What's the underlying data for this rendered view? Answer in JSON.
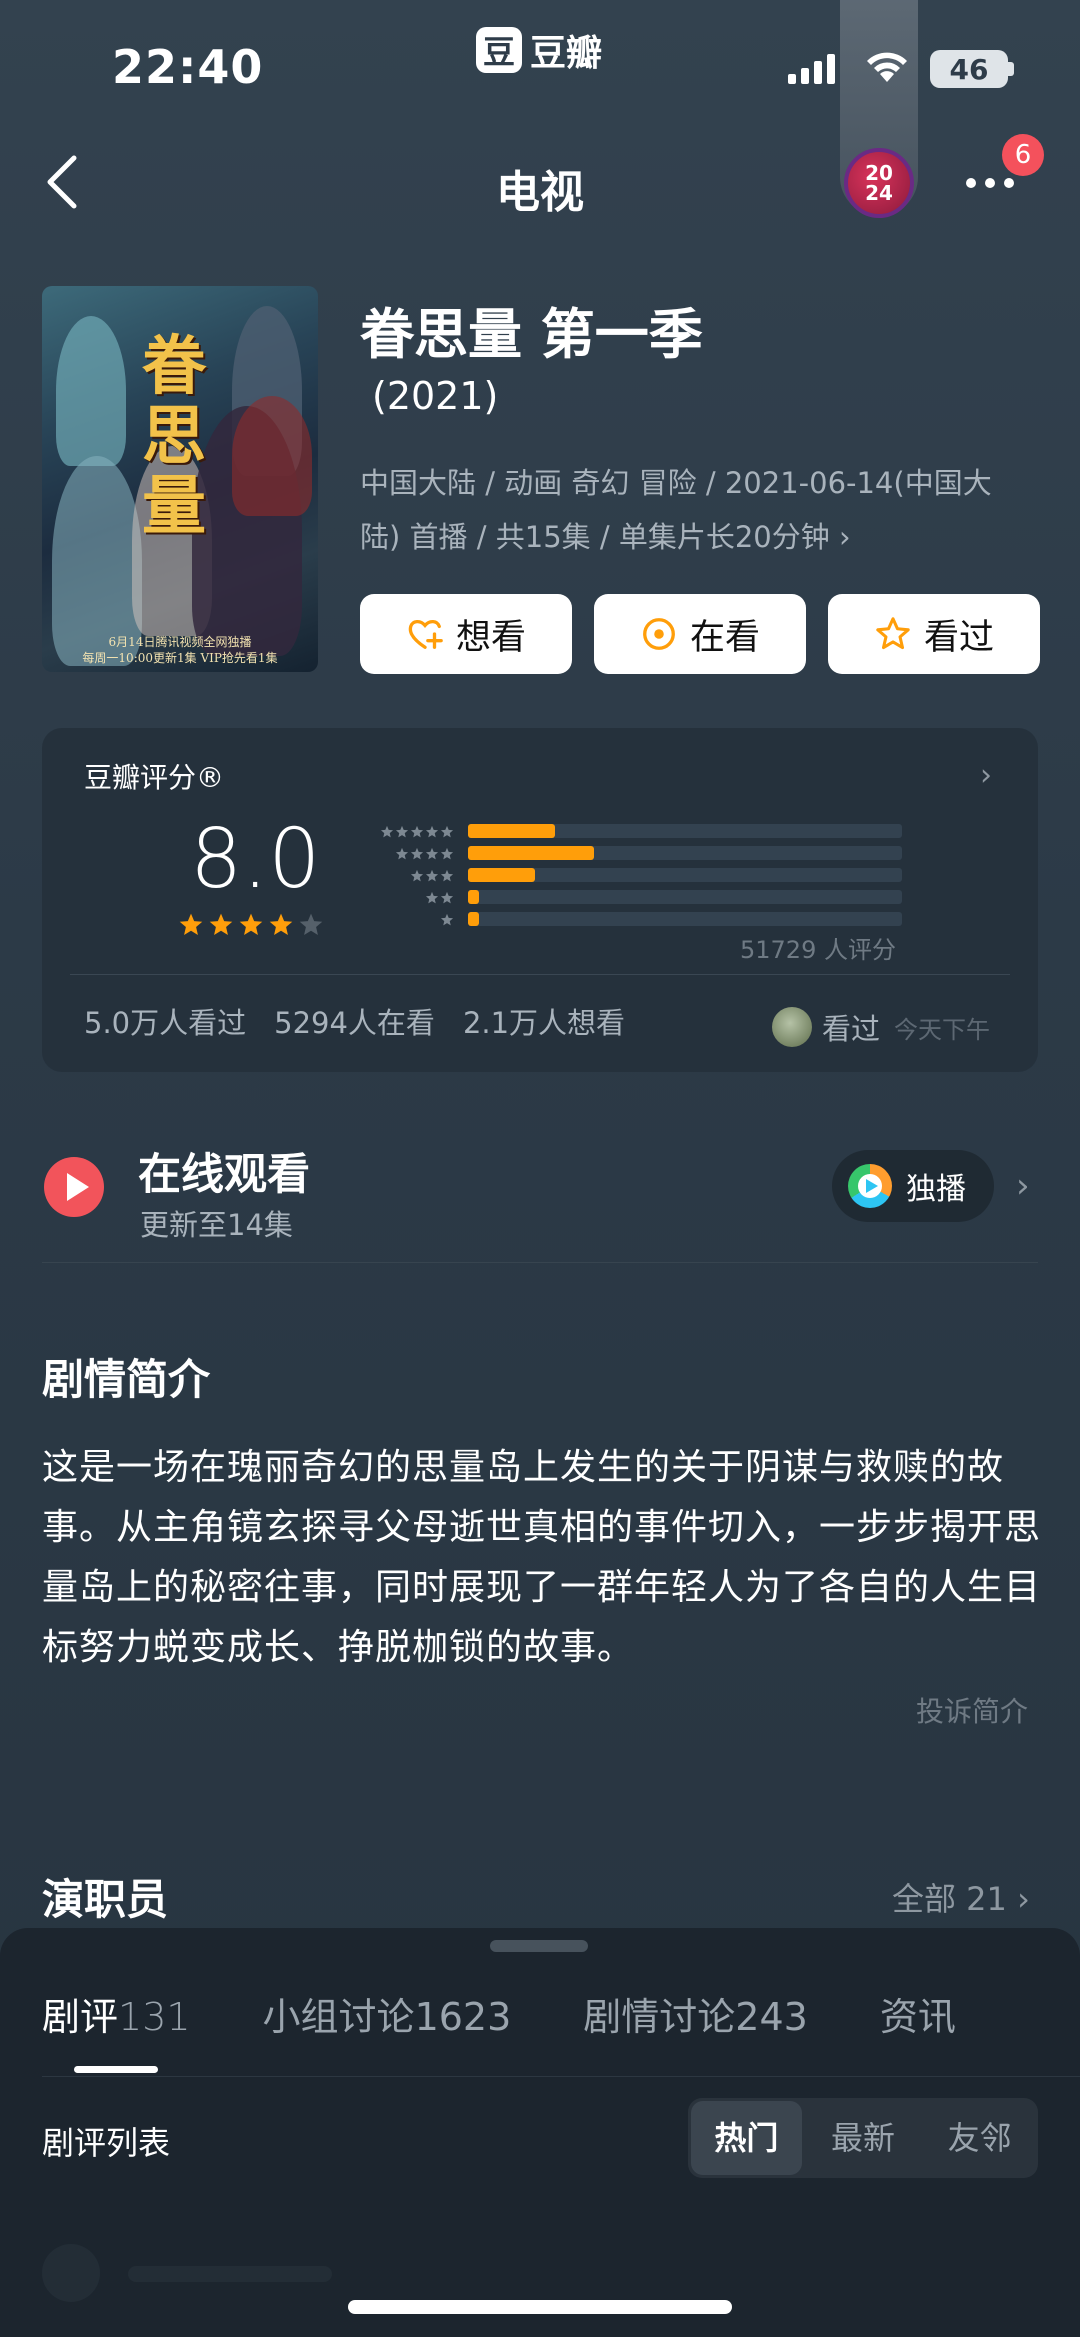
{
  "status_bar": {
    "time": "22:40",
    "battery": "46"
  },
  "app": {
    "logo_char": "豆",
    "name": "豆瓣"
  },
  "nav": {
    "title": "电视",
    "year_badge_top": "20",
    "year_badge_bottom": "24",
    "notification_count": "6"
  },
  "poster": {
    "title_chars": "眷思量",
    "caption_line1": "6月14日腾讯视频全网独播",
    "caption_line2": "每周一10:00更新1集 VIP抢先看1集"
  },
  "show": {
    "title": "眷思量 第一季",
    "year": "(2021)",
    "meta": "中国大陆 / 动画 奇幻 冒险 / 2021-06-14(中国大陆) 首播 / 共15集 / 单集片长20分钟",
    "meta_chevron": "›"
  },
  "actions": [
    {
      "label": "想看",
      "icon": "heart-plus-icon"
    },
    {
      "label": "在看",
      "icon": "target-icon"
    },
    {
      "label": "看过",
      "icon": "star-outline-icon"
    }
  ],
  "rating": {
    "heading": "豆瓣评分®",
    "score": "8.0",
    "stars_filled": 4,
    "stars_total": 5,
    "distribution": [
      {
        "stars": 5,
        "fraction": 0.2
      },
      {
        "stars": 4,
        "fraction": 0.29
      },
      {
        "stars": 3,
        "fraction": 0.155
      },
      {
        "stars": 2,
        "fraction": 0.025
      },
      {
        "stars": 1,
        "fraction": 0.025
      }
    ],
    "votes": "51729 人评分",
    "stats": [
      "5.0万人看过",
      "5294人在看",
      "2.1万人想看"
    ],
    "viewer_label": "看过",
    "viewer_time": "今天下午",
    "accent": "#ff9e0a"
  },
  "watch": {
    "title": "在线观看",
    "subtitle": "更新至14集",
    "platform_label": "独播",
    "chevron": "›"
  },
  "synopsis": {
    "heading": "剧情简介",
    "text": "这是一场在瑰丽奇幻的思量岛上发生的关于阴谋与救赎的故事。从主角镜玄探寻父母逝世真相的事件切入，一步步揭开思量岛上的秘密往事，同时展现了一群年轻人为了各自的人生目标努力蜕变成长、挣脱枷锁的故事。",
    "complain": "投诉简介"
  },
  "cast": {
    "heading": "演职员",
    "all_label": "全部 21 ›"
  },
  "sheet": {
    "tabs": [
      {
        "label": "剧评",
        "count": "131"
      },
      {
        "label": "小组讨论",
        "count": "1623"
      },
      {
        "label": "剧情讨论",
        "count": "243"
      },
      {
        "label": "资讯",
        "count": ""
      }
    ],
    "list_title": "剧评列表",
    "sort_options": [
      "热门",
      "最新",
      "友邻"
    ],
    "sort_selected": "热门"
  }
}
